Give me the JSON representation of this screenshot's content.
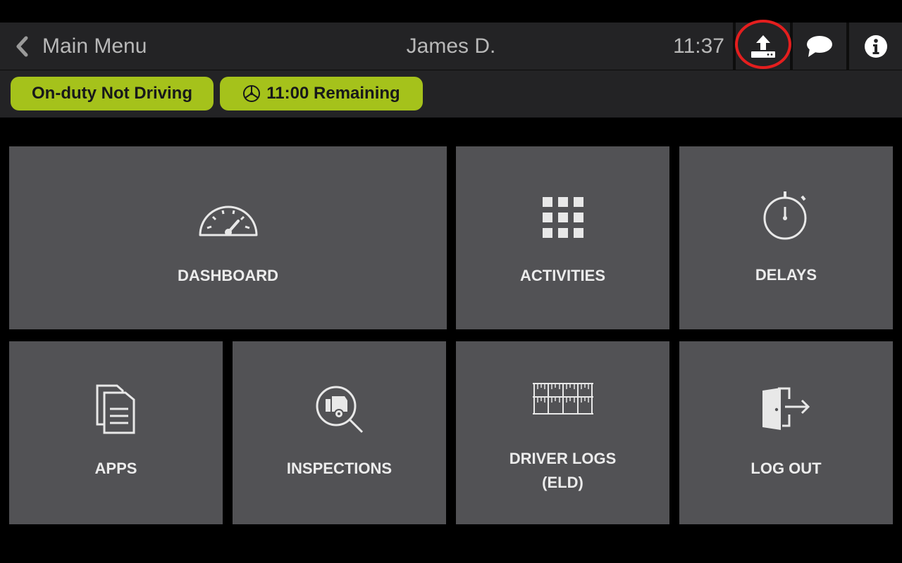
{
  "header": {
    "back_label": "Main Menu",
    "driver_name": "James D.",
    "time": "11:37",
    "actions": [
      "upload-icon",
      "chat-icon",
      "info-icon"
    ]
  },
  "status": {
    "duty_status": "On-duty Not Driving",
    "remaining": "11:00 Remaining"
  },
  "tiles": {
    "dashboard": "DASHBOARD",
    "activities": "ACTIVITIES",
    "delays": "DELAYS",
    "apps": "APPS",
    "inspections": "INSPECTIONS",
    "driver_logs_line1": "DRIVER LOGS",
    "driver_logs_line2": "(ELD)",
    "log_out": "LOG OUT"
  },
  "colors": {
    "accent": "#a5c21b",
    "tile": "#525255",
    "header": "#232325",
    "highlight": "#e41e1e"
  }
}
